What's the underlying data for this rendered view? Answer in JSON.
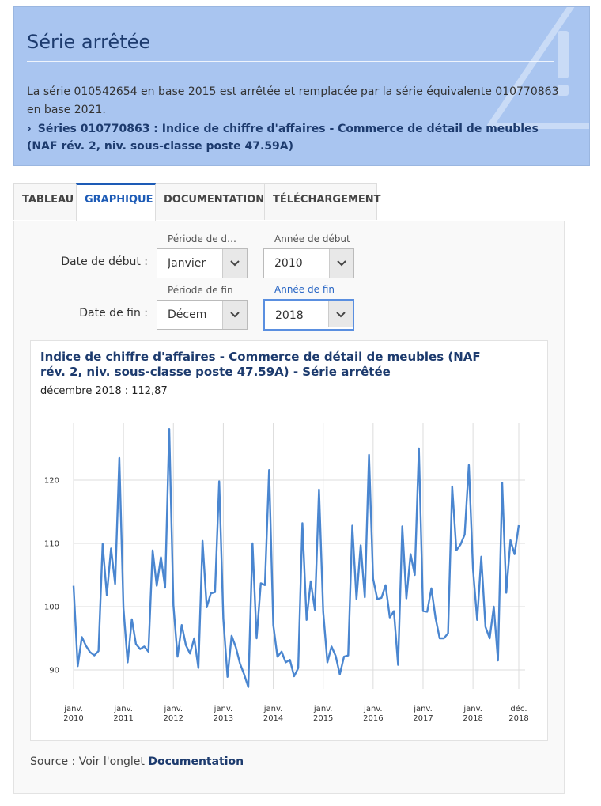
{
  "alert": {
    "title": "Série arrêtée",
    "message": "La série 010542654 en base 2015 est arrêtée et remplacée par la série équivalente 010770863 en base 2021.",
    "link_text": "Séries 010770863 : Indice de chiffre d'affaires - Commerce de détail de meubles (NAF rév. 2, niv. sous-classe poste 47.59A)",
    "link_icon": "chevron-right-icon",
    "background_icon": "warning-triangle-icon"
  },
  "tabs": [
    {
      "label": "TABLEAU",
      "active": false
    },
    {
      "label": "GRAPHIQUE",
      "active": true
    },
    {
      "label": "DOCUMENTATION",
      "active": false
    },
    {
      "label": "TÉLÉCHARGEMENT",
      "active": false
    }
  ],
  "form": {
    "start_label": "Date de début :",
    "end_label": "Date de fin :",
    "start_period_label": "Période de dé…",
    "start_year_label": "Année de début",
    "end_period_label": "Période de fin",
    "end_year_label": "Année de fin",
    "start_period_value": "Janvier",
    "start_year_value": "2010",
    "end_period_value": "Décem",
    "end_year_value": "2018"
  },
  "chart": {
    "title": "Indice de chiffre d'affaires - Commerce de détail de meubles (NAF rév. 2, niv. sous-classe poste 47.59A) - Série arrêtée",
    "subtitle": "décembre 2018 : 112,87",
    "line_color": "#4a86d0"
  },
  "source": {
    "prefix": "Source : Voir l'onglet ",
    "link": "Documentation"
  },
  "chart_data": {
    "type": "line",
    "title": "Indice de chiffre d'affaires - Commerce de détail de meubles (NAF rév. 2, niv. sous-classe poste 47.59A) - Série arrêtée",
    "xlabel": "",
    "ylabel": "",
    "ylim": [
      87,
      129
    ],
    "yticks": [
      90,
      100,
      110,
      120
    ],
    "grid": "vertical lines at each january, horizontal lines at y ticks",
    "legend": "none",
    "xtick_labels": [
      {
        "top": "janv.",
        "bottom": "2010",
        "date": "2010-01"
      },
      {
        "top": "janv.",
        "bottom": "2011",
        "date": "2011-01"
      },
      {
        "top": "janv.",
        "bottom": "2012",
        "date": "2012-01"
      },
      {
        "top": "janv.",
        "bottom": "2013",
        "date": "2013-01"
      },
      {
        "top": "janv.",
        "bottom": "2014",
        "date": "2014-01"
      },
      {
        "top": "janv.",
        "bottom": "2015",
        "date": "2015-01"
      },
      {
        "top": "janv.",
        "bottom": "2016",
        "date": "2016-01"
      },
      {
        "top": "janv.",
        "bottom": "2017",
        "date": "2017-01"
      },
      {
        "top": "janv.",
        "bottom": "2018",
        "date": "2018-01"
      },
      {
        "top": "déc.",
        "bottom": "2018",
        "date": "2018-12"
      }
    ],
    "x_start": "2010-01",
    "x_end": "2018-12",
    "series": [
      {
        "values": [
          103.3,
          90.6,
          95.2,
          93.8,
          92.8,
          92.3,
          93.0,
          109.9,
          101.8,
          109.2,
          103.6,
          123.5,
          99.8,
          91.2,
          98.0,
          94.1,
          93.3,
          93.7,
          92.9,
          108.9,
          103.3,
          107.8,
          103.0,
          128.1,
          100.2,
          92.1,
          97.1,
          93.9,
          92.6,
          95.0,
          90.3,
          110.4,
          99.9,
          102.1,
          102.3,
          119.8,
          98.1,
          88.9,
          95.4,
          93.6,
          91.0,
          89.3,
          87.3,
          110.0,
          95.0,
          103.7,
          103.4,
          121.6,
          97.1,
          92.1,
          92.9,
          91.2,
          91.6,
          89.0,
          90.3,
          113.2,
          97.9,
          104.0,
          99.5,
          118.5,
          99.2,
          91.2,
          93.7,
          92.2,
          89.3,
          92.1,
          92.3,
          112.8,
          101.2,
          109.7,
          101.5,
          124.0,
          104.4,
          101.2,
          101.4,
          103.4,
          98.3,
          99.3,
          90.8,
          112.7,
          101.3,
          108.3,
          105.0,
          125.0,
          99.3,
          99.2,
          102.9,
          98.2,
          95.0,
          95.0,
          95.8,
          119.0,
          108.9,
          109.8,
          111.4,
          122.4,
          106.0,
          97.9,
          107.9,
          96.8,
          95.0,
          100.0,
          91.5,
          119.6,
          102.2,
          110.5,
          108.3,
          112.87
        ]
      }
    ]
  }
}
